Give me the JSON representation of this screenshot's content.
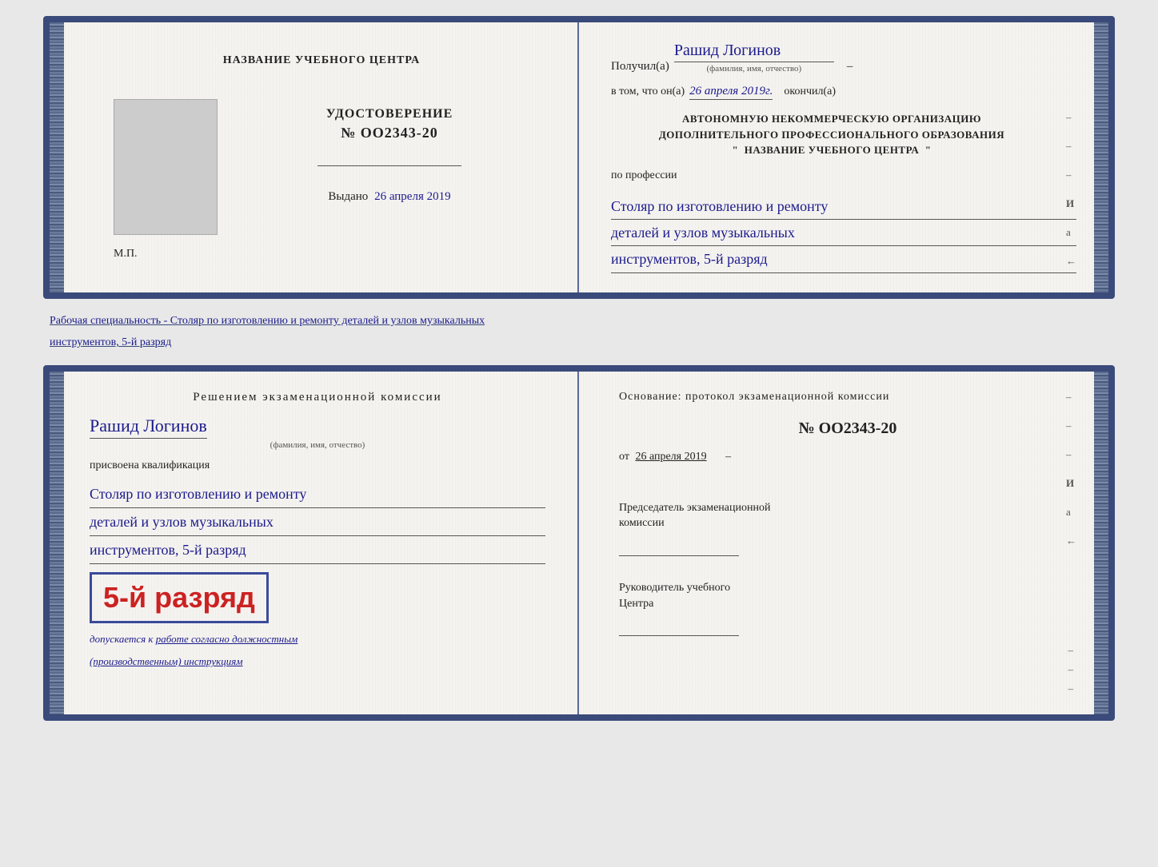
{
  "doc1": {
    "left": {
      "training_center_label": "НАЗВАНИЕ УЧЕБНОГО ЦЕНТРА",
      "udostoverenie_label": "УДОСТОВЕРЕНИЕ",
      "number": "№ OO2343-20",
      "vydano_label": "Выдано",
      "vydano_date": "26 апреля 2019",
      "mp_label": "М.П."
    },
    "right": {
      "poluchil_prefix": "Получил(а)",
      "recipient_name": "Рашид Логинов",
      "fio_subtitle": "(фамилия, имя, отчество)",
      "v_tom_prefix": "в том, что он(а)",
      "completion_date": "26 апреля 2019г.",
      "okончил_label": "окончил(а)",
      "org_block": "АВТОНОМНУЮ НЕКОММЕРЧЕСКУЮ ОРГАНИЗАЦИЮ\nДОПОЛНИТЕЛЬНОГО ПРОФЕССИОНАЛЬНОГО ОБРАЗОВАНИЯ\n\" НАЗВАНИЕ УЧЕБНОГО ЦЕНТРА \"",
      "po_professii_label": "по профессии",
      "profession_line1": "Столяр по изготовлению и ремонту",
      "profession_line2": "деталей и узлов музыкальных",
      "profession_line3": "инструментов, 5-й разряд",
      "dash1": "–",
      "dash2": "–",
      "dash3": "–",
      "i_letter": "И",
      "a_letter": "а",
      "arrow": "←"
    }
  },
  "specialty_text": "Рабочая специальность - Столяр по изготовлению и ремонту деталей и узлов музыкальных",
  "specialty_text2": "инструментов, 5-й разряд",
  "doc2": {
    "left": {
      "resheniem_label": "Решением  экзаменационной  комиссии",
      "name": "Рашид Логинов",
      "fio_subtitle": "(фамилия, имя, отчество)",
      "prisvoena_label": "присвоена квалификация",
      "kvalif_line1": "Столяр по изготовлению и ремонту",
      "kvalif_line2": "деталей и узлов музыкальных",
      "kvalif_line3": "инструментов, 5-й разряд",
      "razryad_big": "5-й разряд",
      "dopuskaetsya_prefix": "допускается к",
      "dopuskaetsya_work": "работе согласно должностным",
      "dopuskaetsya_work2": "(производственным) инструкциям"
    },
    "right": {
      "osnovanie_label": "Основание: протокол экзаменационной  комиссии",
      "number": "№  OO2343-20",
      "ot_prefix": "от",
      "ot_date": "26 апреля 2019",
      "predsedatel_line1": "Председатель экзаменационной",
      "predsedatel_line2": "комиссии",
      "rukovoditel_line1": "Руководитель учебного",
      "rukovoditel_line2": "Центра",
      "dash1": "–",
      "dash2": "–",
      "dash3": "–",
      "i_letter": "И",
      "a_letter": "а",
      "arrow": "←"
    }
  }
}
